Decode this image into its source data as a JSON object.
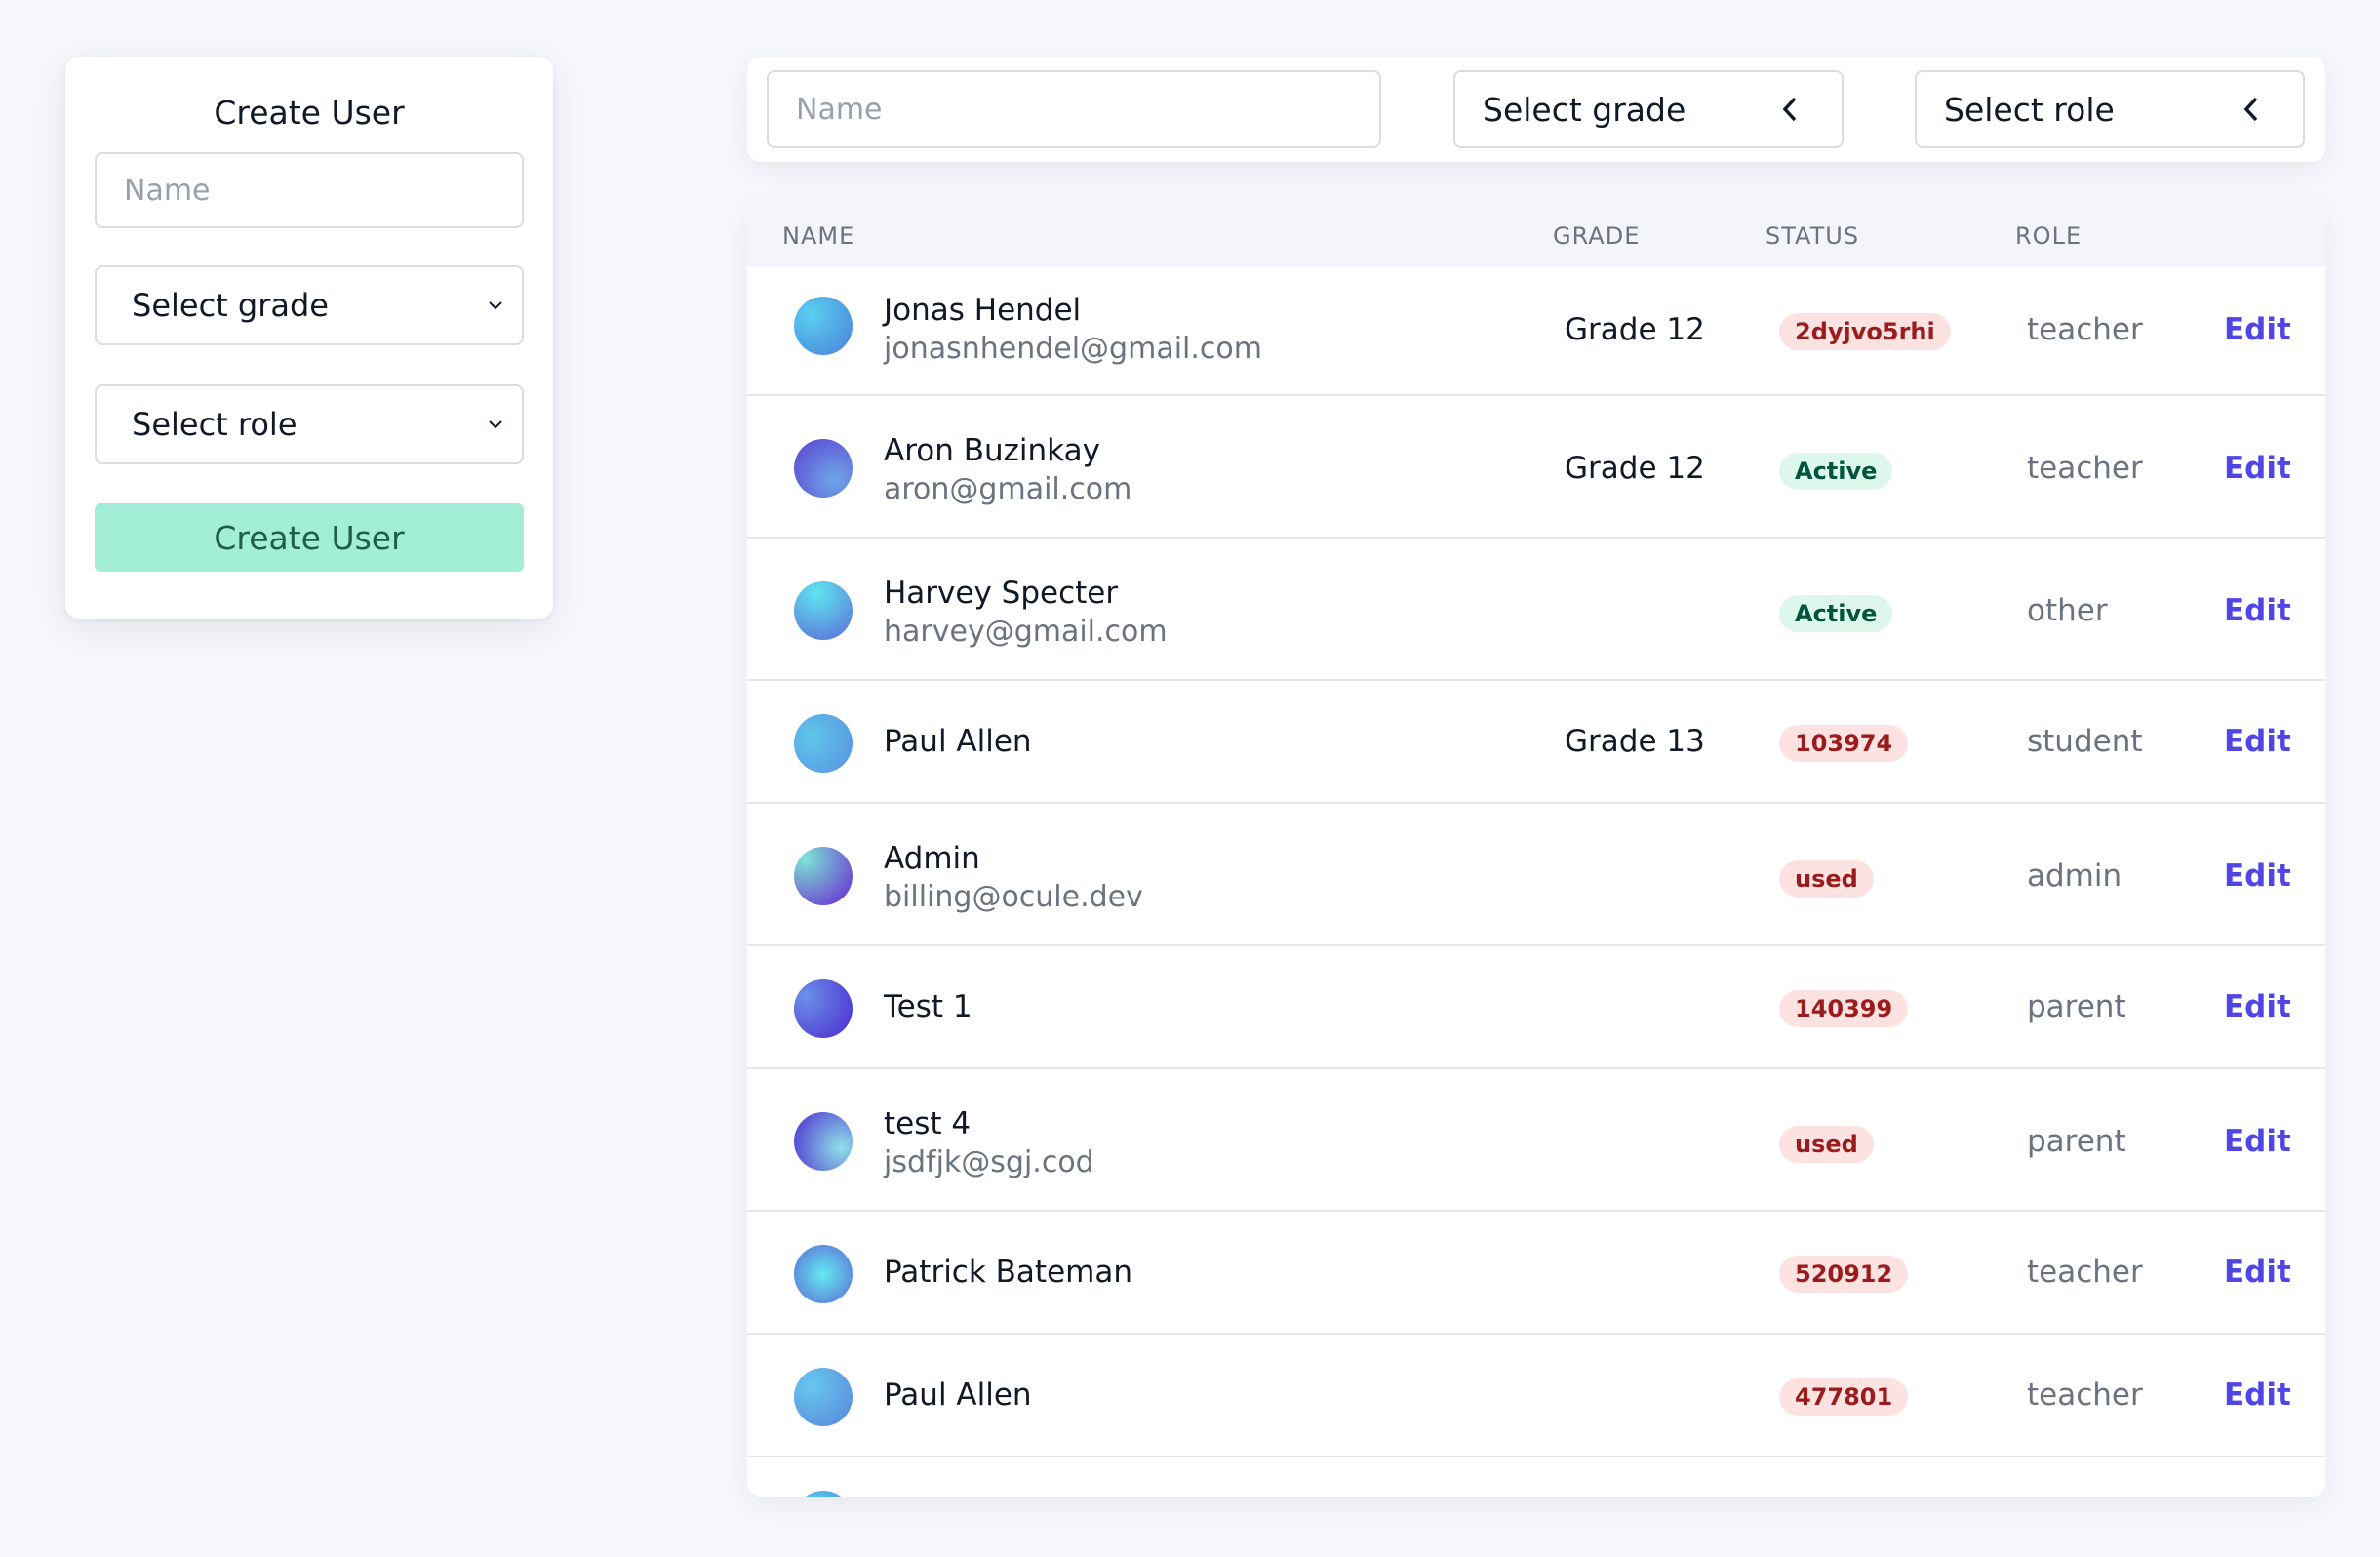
{
  "create_form": {
    "title": "Create User",
    "name_placeholder": "Name",
    "grade_select": "Select grade",
    "role_select": "Select role",
    "submit_label": "Create User"
  },
  "filters": {
    "name_placeholder": "Name",
    "grade_select": "Select grade",
    "role_select": "Select role"
  },
  "table": {
    "headers": {
      "name": "NAME",
      "grade": "GRADE",
      "status": "STATUS",
      "role": "ROLE"
    },
    "edit_label": "Edit",
    "rows": [
      {
        "name": "Jonas Hendel",
        "email": "jonasnhendel@gmail.com",
        "grade": "Grade 12",
        "status": "2dyjvo5rhi",
        "status_color": "red",
        "role": "teacher"
      },
      {
        "name": "Aron Buzinkay",
        "email": "aron@gmail.com",
        "grade": "Grade 12",
        "status": "Active",
        "status_color": "green",
        "role": "teacher"
      },
      {
        "name": "Harvey Specter",
        "email": "harvey@gmail.com",
        "grade": "",
        "status": "Active",
        "status_color": "green",
        "role": "other"
      },
      {
        "name": "Paul Allen",
        "email": "",
        "grade": "Grade 13",
        "status": "103974",
        "status_color": "red",
        "role": "student"
      },
      {
        "name": "Admin",
        "email": "billing@ocule.dev",
        "grade": "",
        "status": "used",
        "status_color": "red",
        "role": "admin"
      },
      {
        "name": "Test 1",
        "email": "",
        "grade": "",
        "status": "140399",
        "status_color": "red",
        "role": "parent"
      },
      {
        "name": "test 4",
        "email": "jsdfjk@sgj.cod",
        "grade": "",
        "status": "used",
        "status_color": "red",
        "role": "parent"
      },
      {
        "name": "Patrick Bateman",
        "email": "",
        "grade": "",
        "status": "520912",
        "status_color": "red",
        "role": "teacher"
      },
      {
        "name": "Paul Allen",
        "email": "",
        "grade": "",
        "status": "477801",
        "status_color": "red",
        "role": "teacher"
      }
    ]
  },
  "colors": {
    "accent": "#4f46e5",
    "create_button_bg": "#a3eed6",
    "badge_red_bg": "#fde2e2",
    "badge_green_bg": "#def7ec"
  }
}
